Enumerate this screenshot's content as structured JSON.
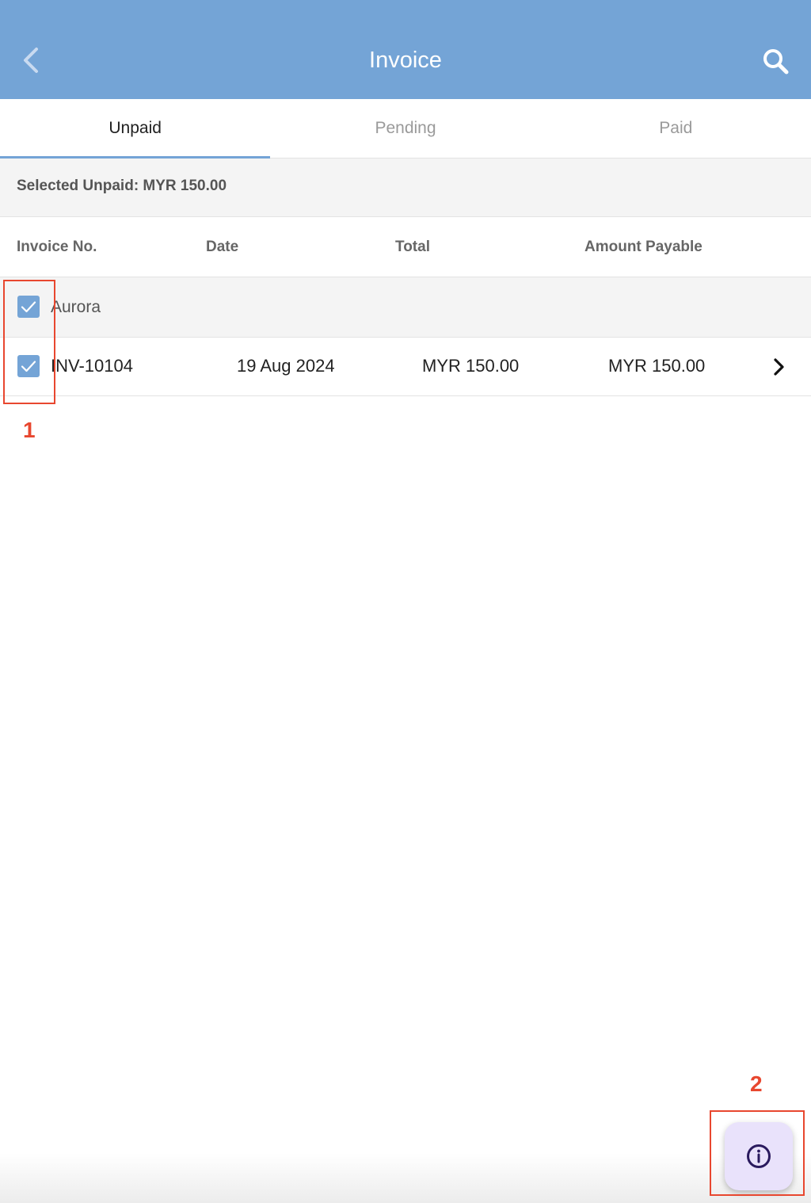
{
  "header": {
    "title": "Invoice",
    "back_icon": "chevron-left-icon",
    "search_icon": "search-icon"
  },
  "tabs": [
    {
      "label": "Unpaid",
      "active": true
    },
    {
      "label": "Pending",
      "active": false
    },
    {
      "label": "Paid",
      "active": false
    }
  ],
  "summary": {
    "text": "Selected Unpaid: MYR 150.00"
  },
  "columns": {
    "invoice_no": "Invoice No.",
    "date": "Date",
    "total": "Total",
    "amount_payable": "Amount Payable"
  },
  "group": {
    "name": "Aurora",
    "checked": true
  },
  "invoices": [
    {
      "invoice_no": "INV-10104",
      "date": "19 Aug 2024",
      "total": "MYR 150.00",
      "amount_payable": "MYR 150.00",
      "checked": true
    }
  ],
  "annotations": {
    "label_1": "1",
    "label_2": "2"
  },
  "fab": {
    "icon": "info-icon"
  },
  "colors": {
    "header": "#74a4d6",
    "accent": "#74a4d6",
    "annotation": "#e8472f",
    "fab_bg": "#e9e2fb",
    "fab_icon": "#2a1a5e"
  }
}
